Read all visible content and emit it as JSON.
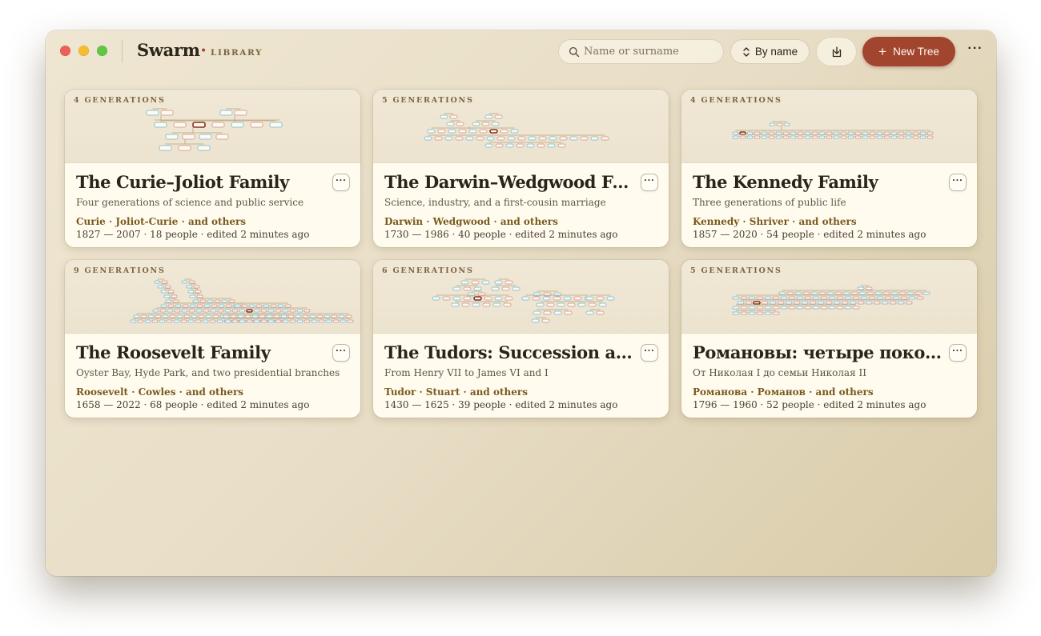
{
  "window": {
    "brand": "Swarm",
    "separator": "•",
    "section": "LIBRARY"
  },
  "toolbar": {
    "search_placeholder": "Name or surname",
    "sort_label": "By name",
    "new_tree_label": "New Tree",
    "plus_glyph": "+",
    "more_glyph": "···"
  },
  "colors": {
    "accent": "#a2452f",
    "node_blue": "#8ec4d6",
    "node_pink": "#d4a49c",
    "node_highlight": "#8a2f1e"
  },
  "cards": [
    {
      "generations": "4 GENERATIONS",
      "title": "The Curie–Joliot Family",
      "subtitle": "Four generations of science and public service",
      "surnames": "Curie · Joliot-Curie · and others",
      "meta": "1827 — 2007 · 18 people · edited 2 minutes ago",
      "menu": "···"
    },
    {
      "generations": "5 GENERATIONS",
      "title": "The Darwin–Wedgwood Fa...",
      "subtitle": "Science, industry, and a first-cousin marriage",
      "surnames": "Darwin · Wedgwood · and others",
      "meta": "1730 — 1986 · 40 people · edited 2 minutes ago",
      "menu": "···"
    },
    {
      "generations": "4 GENERATIONS",
      "title": "The Kennedy Family",
      "subtitle": "Three generations of public life",
      "surnames": "Kennedy · Shriver · and others",
      "meta": "1857 — 2020 · 54 people · edited 2 minutes ago",
      "menu": "···"
    },
    {
      "generations": "9 GENERATIONS",
      "title": "The Roosevelt Family",
      "subtitle": "Oyster Bay, Hyde Park, and two presidential branches",
      "surnames": "Roosevelt · Cowles · and others",
      "meta": "1658 — 2022 · 68 people · edited 2 minutes ago",
      "menu": "···"
    },
    {
      "generations": "6 GENERATIONS",
      "title": "The Tudors: Succession and...",
      "subtitle": "From Henry VII to James VI and I",
      "surnames": "Tudor · Stuart · and others",
      "meta": "1430 — 1625 · 39 people · edited 2 minutes ago",
      "menu": "···"
    },
    {
      "generations": "5 GENERATIONS",
      "title": "Романовы: четыре поколе...",
      "subtitle": "От Николая I до семьи Николая II",
      "surnames": "Романова · Романов · and others",
      "meta": "1796 — 1960 · 52 people · edited 2 minutes ago",
      "menu": "···"
    }
  ]
}
